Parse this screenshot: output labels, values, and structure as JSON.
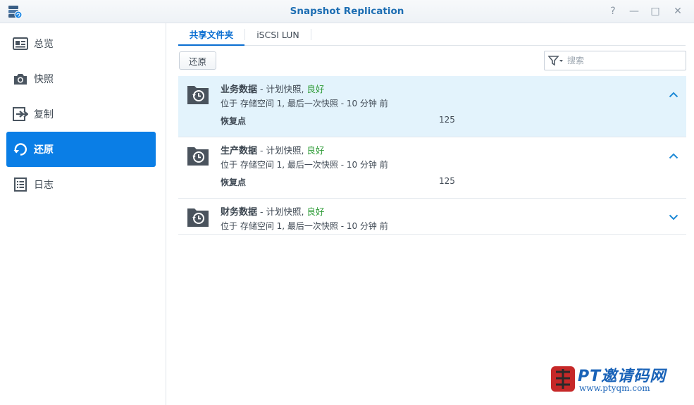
{
  "window": {
    "title": "Snapshot Replication",
    "help_label": "?",
    "minimize_label": "—",
    "maximize_label": "□",
    "close_label": "✕"
  },
  "sidebar": {
    "items": [
      {
        "label": "总览",
        "icon": "overview-icon",
        "active": false
      },
      {
        "label": "快照",
        "icon": "camera-icon",
        "active": false
      },
      {
        "label": "复制",
        "icon": "replication-icon",
        "active": false
      },
      {
        "label": "还原",
        "icon": "restore-icon",
        "active": true
      },
      {
        "label": "日志",
        "icon": "log-icon",
        "active": false
      }
    ]
  },
  "tabs": [
    {
      "label": "共享文件夹",
      "active": true
    },
    {
      "label": "iSCSI LUN",
      "active": false
    }
  ],
  "toolbar": {
    "restore_label": "还原",
    "search_placeholder": "搜索"
  },
  "list": [
    {
      "name": "业务数据",
      "schedule": " - 计划快照, ",
      "status": "良好",
      "location": "位于 存储空间 1, 最后一次快照 - 10 分钟 前",
      "restore_points_label": "恢复点",
      "restore_points": "125",
      "expanded": true,
      "selected": true
    },
    {
      "name": "生产数据",
      "schedule": " - 计划快照, ",
      "status": "良好",
      "location": "位于 存储空间 1, 最后一次快照 - 10 分钟 前",
      "restore_points_label": "恢复点",
      "restore_points": "125",
      "expanded": true,
      "selected": false
    },
    {
      "name": "财务数据",
      "schedule": " - 计划快照, ",
      "status": "良好",
      "location": "位于 存储空间 1, 最后一次快照 - 10 分钟 前",
      "expanded": false,
      "selected": false
    }
  ],
  "watermark": {
    "brand": "PT邀请码网",
    "url": "www.ptyqm.com"
  },
  "colors": {
    "accent": "#0a7ee6",
    "title": "#1d6eb3",
    "status_good": "#2f9c38",
    "selected_row": "#e3f3fc"
  }
}
